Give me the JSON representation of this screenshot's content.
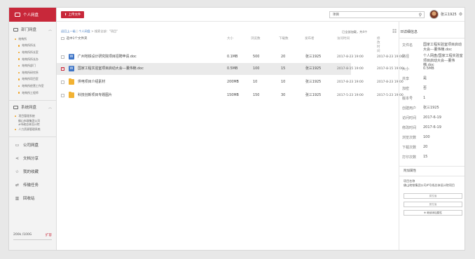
{
  "sidebar": {
    "personal": "个人网盘",
    "dept_group": "部门网盘",
    "dept_items": [
      "结构所",
      "结构所所长",
      "结构所所长室",
      "结构所所长办",
      "结构所部门",
      "结构所研究所",
      "结构所项目室",
      "结构所经营工作室",
      "结构所工程师"
    ],
    "sys_group": "系统网盘",
    "sys_items": [
      "项目管理系统",
      "佛山市政集团公司",
      "#市政总体设计院",
      "人力资源管理系统"
    ],
    "nav": [
      "公司网盘",
      "文档分享",
      "我的收藏",
      "传输任务",
      "回收站"
    ],
    "quota": "200k /100G",
    "expand": "扩容"
  },
  "toolbar": {
    "upload": "上传文件",
    "search_value": "项目",
    "user": "张三1925"
  },
  "main": {
    "crumb_back": "返回上一级",
    "crumb_sep": "|",
    "crumb_path": "个人网盘",
    "crumb_tail": " > 搜索全部：\"项目\"",
    "check_all": "选中1个文件夹",
    "loaded": "已全部加载，共4个",
    "headers": {
      "size": "大小",
      "views": "浏览数",
      "downloads": "下载数",
      "publisher": "发布者",
      "access": "访问时间",
      "modified": "修改时间"
    },
    "rows": [
      {
        "name": "广州地铁设计研究院项目招聘申请.doc",
        "size": "0.1MB",
        "views": "500",
        "downloads": "20",
        "publisher": "张三1925",
        "access": "2017-8-23  19:00",
        "modified": "2017-8-23  19:00",
        "selected": false,
        "kind": "doc"
      },
      {
        "name": "国家工程实验室项目启动大会---董伟楠.doc",
        "size": "0.5MB",
        "views": "100",
        "downloads": "15",
        "publisher": "张三1925",
        "access": "2017-8-15  19:00",
        "modified": "2017-8-15  19:00",
        "selected": true,
        "kind": "doc"
      },
      {
        "name": "供电项目介绍素材",
        "size": "200MB",
        "views": "10",
        "downloads": "10",
        "publisher": "张三1925",
        "access": "2017-8-23  19:00",
        "modified": "2017-8-23  19:00",
        "selected": false,
        "kind": "folder"
      },
      {
        "name": "科技创新项目专题图片",
        "size": "150MB",
        "views": "150",
        "downloads": "30",
        "publisher": "张三1925",
        "access": "2017-5-23  19:00",
        "modified": "2017-5-23  19:00",
        "selected": false,
        "kind": "folder"
      }
    ]
  },
  "details": {
    "title": "详细信息",
    "fields": [
      {
        "k": "文件名",
        "v": "国家工程实验室项目启动大会---董伟楠.doc"
      },
      {
        "k": "路径",
        "v": "个人网盘/国家工程实验室项目启动大会---董伟楠.doc"
      },
      {
        "k": "大小",
        "v": "0.5MB"
      },
      {
        "k": "共享",
        "v": "是"
      },
      {
        "k": "加密",
        "v": "否"
      },
      {
        "k": "版本号",
        "v": "1"
      },
      {
        "k": "创建用户",
        "v": "张三1925"
      },
      {
        "k": "访问时间",
        "v": "2017-6-19"
      },
      {
        "k": "修改时间",
        "v": "2017-6-19"
      },
      {
        "k": "浏览次数",
        "v": "100"
      },
      {
        "k": "下载次数",
        "v": "20"
      },
      {
        "k": "打印次数",
        "v": "15"
      }
    ],
    "attr_title": "附加属性",
    "proj_label": "项目名称",
    "proj_value": "佛山地铁集团公司#号线总体设计院项目",
    "btn1": "属性值",
    "btn2": "属性值",
    "add_btn": "⊕ 继续添加属性"
  }
}
